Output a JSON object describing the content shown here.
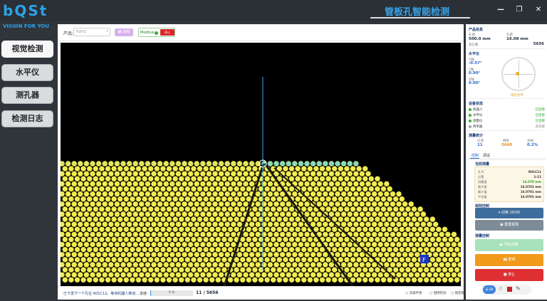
{
  "app": {
    "brand": "bQSt",
    "slogan": "VISION FOR YOU",
    "title": "管板孔智能检测",
    "win_minimize": "—",
    "win_restore": "❐",
    "win_close": "✕"
  },
  "nav": {
    "items": [
      {
        "label": "视觉检测",
        "active": true
      },
      {
        "label": "水平仪",
        "active": false
      },
      {
        "label": "测孔器",
        "active": false
      },
      {
        "label": "检测日志",
        "active": false
      }
    ]
  },
  "toolbar": {
    "product_label": "产品:",
    "product_value": "H2H2",
    "load_button": "加载",
    "modbus_label": "Modbus",
    "modbus_stop": "停止"
  },
  "viewport": {
    "marker_label": "F",
    "dot_color": "#f2ec54",
    "highlight_color": "#8fe0b8",
    "crosshair_color": "#3aa9e6"
  },
  "status": {
    "message": "已下发下一个孔位 R01C12。等待机器人移动...",
    "progress_label": "进度:",
    "progress_text": "0 %",
    "progress_fraction": 0.002,
    "progress_count": "11 / 5656",
    "options": [
      "去噪平移",
      "阻碍检验",
      "锁定缩放"
    ]
  },
  "right": {
    "product_info_title": "产品信息",
    "hole_diameter_label": "孔径",
    "hole_diameter_value": "500.0 mm",
    "pitch_label": "孔距",
    "pitch_value": "16.08 mm",
    "total_label": "总孔数",
    "total_value": "5656",
    "level_title": "水平仪",
    "x_label": "X轴",
    "x_value": "-0.57°",
    "y_label": "Y轴",
    "y_value": "0.90°",
    "z_label": "Z轴",
    "z_value": "0.00°",
    "level_status": "接近水平",
    "device_title": "设备状态",
    "devices": [
      {
        "name": "机器人",
        "state": "已连接",
        "online": true
      },
      {
        "name": "水平仪",
        "state": "已连接",
        "online": true
      },
      {
        "name": "测量仪",
        "state": "已连接",
        "online": true
      },
      {
        "name": "简单器",
        "state": "未连接",
        "online": false
      }
    ],
    "stats_title": "测量统计",
    "stat_done_label": "已测",
    "stat_done_value": "11",
    "stat_left_label": "剩余",
    "stat_left_value": "5645",
    "stat_rate_label": "合格",
    "stat_rate_value": "0.2%",
    "tabs": [
      "控制",
      "调试"
    ],
    "current_title": "当前测量",
    "current_rows": [
      {
        "k": "孔号",
        "v": "R01C11"
      },
      {
        "k": "位置",
        "v": "1-11"
      },
      {
        "k": "测量值",
        "v": "16.070 mm"
      },
      {
        "k": "最大值",
        "v": "16.0701 mm"
      },
      {
        "k": "最小值",
        "v": "16.0701 mm"
      },
      {
        "k": "平均值",
        "v": "16.0701 mm"
      }
    ],
    "plan_title": "规则控制",
    "plan_button": "切换 20/30",
    "reset_button": "重置视场",
    "control_title": "测量控制",
    "start_button": "开始测量",
    "pause_button": "暂停",
    "stop_button": "停止",
    "colors": {
      "start": "#a8e2bd",
      "pause": "#f19a1b",
      "stop": "#de2f33",
      "plan": "#3e6d9c",
      "reset": "#7d8c97"
    }
  },
  "tray": {
    "lang_label": "英 EN"
  }
}
